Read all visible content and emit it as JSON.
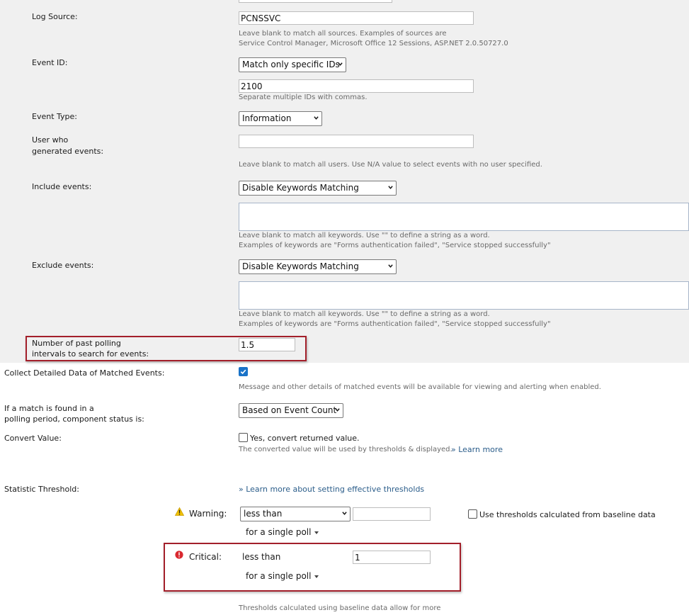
{
  "form": {
    "log_source": {
      "label": "Log Source:",
      "value": "PCNSSVC",
      "hint1": "Leave blank to match all sources. Examples of sources are",
      "hint2": "Service Control Manager, Microsoft Office 12 Sessions, ASP.NET 2.0.50727.0"
    },
    "event_id": {
      "label": "Event ID:",
      "mode": "Match only specific IDs",
      "value": "2100",
      "hint": "Separate multiple IDs with commas."
    },
    "event_type": {
      "label": "Event Type:",
      "value": "Information"
    },
    "user": {
      "label_line1": "User who",
      "label_line2": "generated events:",
      "value": "",
      "hint": "Leave blank to match all users. Use N/A value to select events with no user specified."
    },
    "include_events": {
      "label": "Include events:",
      "mode": "Disable Keywords Matching",
      "hint1": "Leave blank to match all keywords. Use \"\" to define a string as a word.",
      "hint2": "Examples of keywords are \"Forms authentication failed\", \"Service stopped successfully\""
    },
    "exclude_events": {
      "label": "Exclude events:",
      "mode": "Disable Keywords Matching",
      "hint1": "Leave blank to match all keywords. Use \"\" to define a string as a word.",
      "hint2": "Examples of keywords are \"Forms authentication failed\", \"Service stopped successfully\""
    },
    "polling_intervals": {
      "label_line1": "Number of past polling",
      "label_line2": "intervals to search for events:",
      "value": "1.5"
    },
    "collect_detailed": {
      "label": "Collect Detailed Data of Matched Events:",
      "checked": true,
      "hint": "Message and other details of matched events will be available for viewing and alerting when enabled."
    },
    "match_status": {
      "label_line1": "If a match is found in a",
      "label_line2": "polling period, component status is:",
      "value": "Based on Event Count"
    },
    "convert_value": {
      "label": "Convert Value:",
      "checkbox_label": "Yes, convert returned value.",
      "checked": false,
      "hint": "The converted value will be used by thresholds & displayed.",
      "learn_more": "» Learn more"
    },
    "statistic_threshold": {
      "label": "Statistic Threshold:",
      "learn_more": "» Learn more about setting effective thresholds",
      "warning": {
        "label": "Warning:",
        "operator": "less than",
        "value": "",
        "period": "for a single poll",
        "baseline_label": "Use thresholds calculated from baseline data"
      },
      "critical": {
        "label": "Critical:",
        "operator": "less than",
        "value": "1",
        "period": "for a single poll"
      },
      "footer_hint": "Thresholds calculated using baseline data allow for more"
    }
  },
  "colors": {
    "panel_bg": "#f0f0f0",
    "highlight_red": "#a31f2a",
    "link": "#2b5d8a",
    "checkbox_blue": "#1a73c8",
    "warning_yellow": "#f2c200",
    "critical_red": "#d9282f"
  },
  "icons": {
    "warning": "warning-triangle-icon",
    "critical": "critical-circle-icon"
  }
}
